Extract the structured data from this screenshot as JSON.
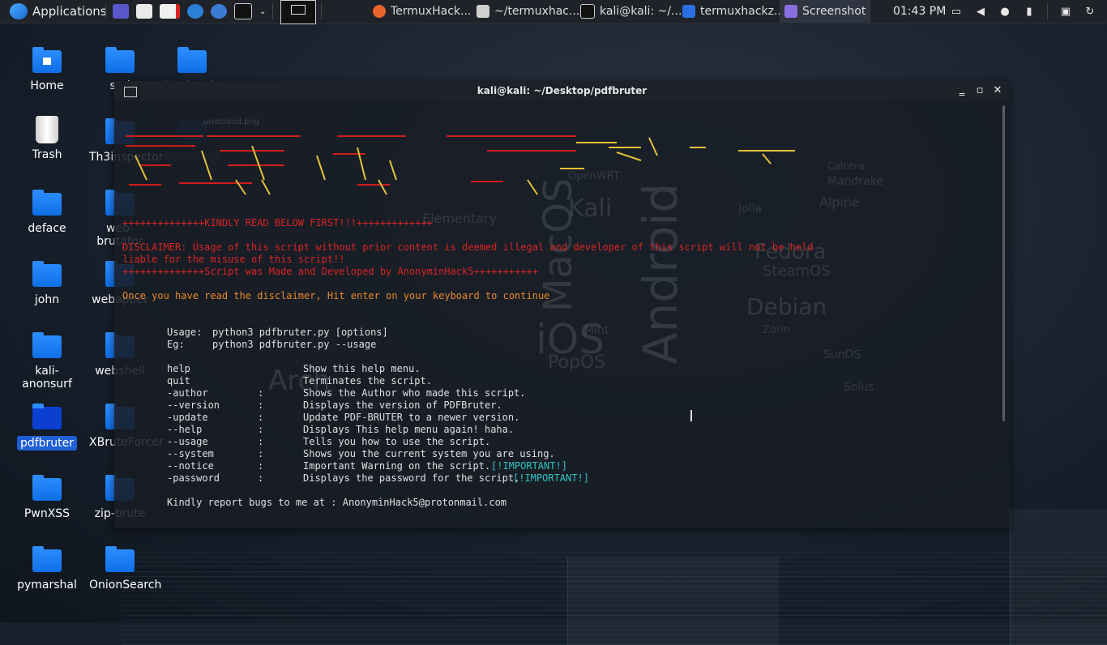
{
  "panel": {
    "applications_label": "Applications",
    "tasks": [
      {
        "label": "TermuxHack...",
        "icon": "firefox-icon"
      },
      {
        "label": "~/termuxhac...",
        "icon": "editor-icon"
      },
      {
        "label": "kali@kali: ~/...",
        "icon": "terminal-icon"
      },
      {
        "label": "termuxhackz...",
        "icon": "folder-icon"
      },
      {
        "label": "Screenshot",
        "icon": "screenshot-icon"
      }
    ],
    "clock": "01:43 PM"
  },
  "desktop_icons": [
    {
      "label": "Home"
    },
    {
      "label": "sud"
    },
    {
      "label": "bashrock"
    },
    {
      "label": "Trash"
    },
    {
      "label": "Th3inspector"
    },
    {
      "label": "btc-miner"
    },
    {
      "label": "deface"
    },
    {
      "label": "web-brutator"
    },
    {
      "label": "john"
    },
    {
      "label": "webapper"
    },
    {
      "label": "kali-anonsurf"
    },
    {
      "label": "webshell"
    },
    {
      "label": "pdfbruter"
    },
    {
      "label": "XBruteForcer"
    },
    {
      "label": "PwnXSS"
    },
    {
      "label": "zip-brute"
    },
    {
      "label": "pymarshal"
    },
    {
      "label": "OnionSearch"
    }
  ],
  "ghost_file": "unisclsud.png",
  "terminal": {
    "title": "kali@kali: ~/Desktop/pdfbruter",
    "kindly_read": "++++++++++++++KINDLY READ BELOW FIRST!!!+++++++++++++",
    "disclaimer_1": "DISCLAIMER: Usage of this script without prior content is deemed illegal and developer of this script will not be held",
    "disclaimer_2": "liable for the misuse of this script!!",
    "made_by": "++++++++++++++Script was Made and Developed by AnonyminHack5+++++++++++",
    "continue_msg": "Once you have read the disclaimer, Hit enter on your keyboard to continue",
    "usage_label": "Usage:",
    "usage_cmd": "python3 pdfbruter.py [options]",
    "eg_label": "Eg:",
    "eg_cmd": "python3 pdfbruter.py --usage",
    "options": [
      {
        "opt": "help",
        "sep": "",
        "desc": "Show this help menu.",
        "flag": ""
      },
      {
        "opt": "quit",
        "sep": "",
        "desc": "Terminates the script.",
        "flag": ""
      },
      {
        "opt": "-author",
        "sep": ":",
        "desc": "Shows the Author who made this script.",
        "flag": ""
      },
      {
        "opt": "--version",
        "sep": ":",
        "desc": "Displays the version of PDFBruter.",
        "flag": ""
      },
      {
        "opt": "-update",
        "sep": ":",
        "desc": "Update PDF-BRUTER to a newer version.",
        "flag": ""
      },
      {
        "opt": "--help",
        "sep": ":",
        "desc": "Displays This help menu again! haha.",
        "flag": ""
      },
      {
        "opt": "--usage",
        "sep": ":",
        "desc": "Tells you how to use the script.",
        "flag": ""
      },
      {
        "opt": "--system",
        "sep": ":",
        "desc": "Shows you the current system you are using.",
        "flag": ""
      },
      {
        "opt": "--notice",
        "sep": ":",
        "desc": "Important Warning on the script. ",
        "flag": "[!IMPORTANT!]"
      },
      {
        "opt": "-password",
        "sep": ":",
        "desc": "Displays the password for the script.",
        "flag": "[!IMPORTANT!]"
      }
    ],
    "report": "Kindly report bugs to me at : AnonyminHack5@protonmail.com"
  },
  "colors": {
    "red": "#d62525",
    "orange": "#e78a2c",
    "cyan": "#2fc4c0",
    "selection": "#1f5fd6"
  }
}
